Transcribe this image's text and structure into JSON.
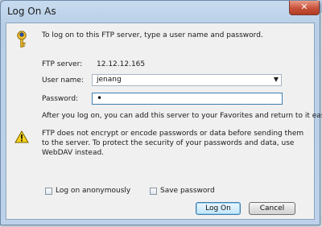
{
  "dialog": {
    "title": "Log On As",
    "close_glyph": "✕",
    "intro": "To log on to this FTP server, type a user name and password.",
    "ftp_server_label": "FTP server:",
    "ftp_server_value": "12.12.12.165",
    "user_name_label": "User name:",
    "user_name_value": "jenang",
    "password_label": "Password:",
    "password_value": "•",
    "note": "After you log on, you can add this server to your Favorites and return to it easily.",
    "warning": "FTP does not encrypt or encode passwords or data before sending them to the server.  To protect the security of your passwords and data, use WebDAV instead.",
    "anonymous_label": "Log on anonymously",
    "save_password_label": "Save password",
    "log_on_button": "Log On",
    "cancel_button": "Cancel"
  },
  "icons": {
    "key": "key-icon",
    "warning": "warning-icon",
    "dropdown": "chevron-down-icon",
    "close": "close-icon"
  },
  "colors": {
    "close_button": "#c7513a",
    "focus_border": "#3c7fb1",
    "warning_yellow": "#f5d21a"
  }
}
